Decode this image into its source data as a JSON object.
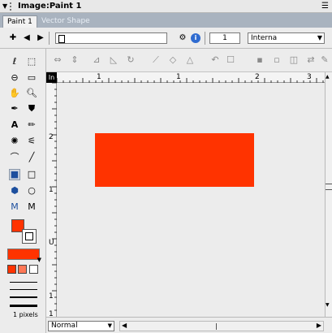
{
  "window": {
    "title": "Image:Paint 1",
    "menu_icon": "panel-menu-icon"
  },
  "tabs": [
    {
      "label": "Paint 1",
      "active": true
    },
    {
      "label": "Vector Shape",
      "active": false
    }
  ],
  "toolbar": {
    "frame_number": "1",
    "ink_select": "Interna",
    "icons": [
      "plus-icon",
      "prev-icon",
      "play-icon",
      "next-icon",
      "onion-icon",
      "info-icon"
    ]
  },
  "rulers": {
    "horizontal": [
      "1",
      "1",
      "2",
      "3"
    ],
    "vertical": [
      "2",
      "1",
      "U",
      "1",
      "1"
    ],
    "origin_label": "In"
  },
  "tools_panel": {
    "stroke_width_label": "1 pixels"
  },
  "canvas": {
    "shape_color": "#ff3300"
  },
  "statusbar": {
    "blend_mode": "Normal"
  },
  "colors": {
    "accent": "#ff3300",
    "tab_bar": "#a9b3bf"
  }
}
